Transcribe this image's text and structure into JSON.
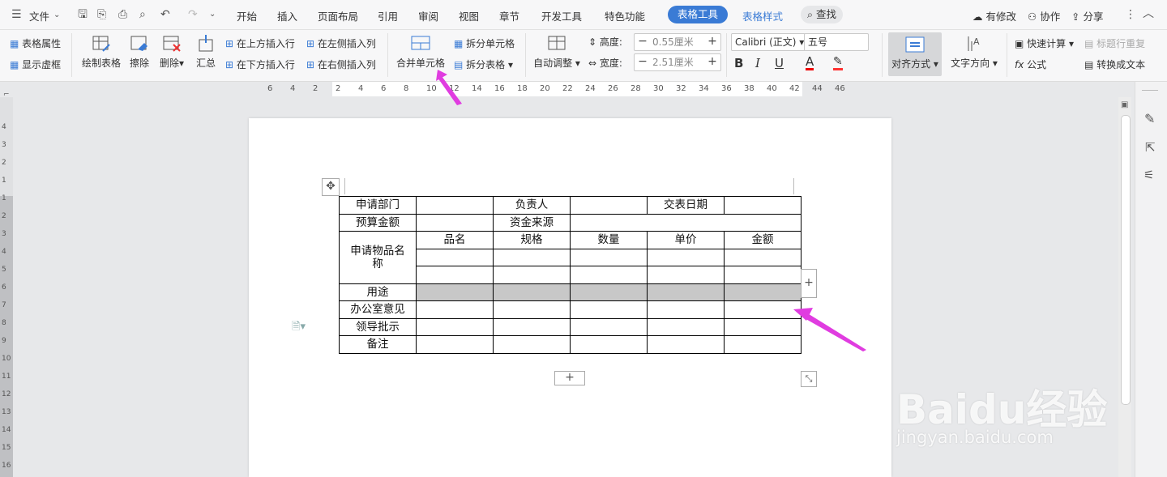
{
  "menubar": {
    "file_label": "文件",
    "tabs": [
      "开始",
      "插入",
      "页面布局",
      "引用",
      "审阅",
      "视图",
      "章节",
      "开发工具",
      "特色功能"
    ],
    "active_tab": "表格工具",
    "secondary_tab": "表格样式",
    "search_label": "查找",
    "changes_label": "有修改",
    "collab_label": "协作",
    "share_label": "分享"
  },
  "ribbon": {
    "table_props": "表格属性",
    "show_gridlines": "显示虚框",
    "draw_table": "绘制表格",
    "erase": "擦除",
    "delete": "删除",
    "summary": "汇总",
    "insert_above": "在上方插入行",
    "insert_below": "在下方插入行",
    "insert_left": "在左侧插入列",
    "insert_right": "在右侧插入列",
    "merge_cells": "合并单元格",
    "split_cells": "拆分单元格",
    "split_table": "拆分表格",
    "auto_fit": "自动调整",
    "height_label": "高度:",
    "height_value": "0.55厘米",
    "width_label": "宽度:",
    "width_value": "2.51厘米",
    "font_name": "Calibri (正文)",
    "font_size": "五号",
    "align": "对齐方式",
    "text_dir": "文字方向",
    "quick_calc": "快速计算",
    "repeat_header": "标题行重复",
    "formula": "公式",
    "to_text": "转换成文本"
  },
  "ruler": {
    "numbers": [
      "6",
      "4",
      "2",
      "2",
      "4",
      "6",
      "8",
      "10",
      "12",
      "14",
      "16",
      "18",
      "20",
      "22",
      "24",
      "26",
      "28",
      "30",
      "32",
      "34",
      "36",
      "38",
      "40",
      "42",
      "44",
      "46"
    ],
    "vertical": [
      "4",
      "3",
      "2",
      "1",
      "1",
      "2",
      "3",
      "4",
      "5",
      "6",
      "7",
      "8",
      "9",
      "10",
      "11",
      "12",
      "13",
      "14",
      "15",
      "16"
    ]
  },
  "table": {
    "rows": [
      [
        "申请部门",
        "",
        "负责人",
        "",
        "交表日期",
        ""
      ],
      [
        "预算金额",
        "",
        "资金来源",
        ""
      ],
      [
        "申请物品名称",
        "品名",
        "规格",
        "数量",
        "单价",
        "金额"
      ],
      [
        "",
        "",
        "",
        "",
        ""
      ],
      [
        "",
        "",
        "",
        "",
        ""
      ],
      [
        "用途",
        "",
        "",
        "",
        "",
        ""
      ],
      [
        "办公室意见",
        "",
        "",
        "",
        "",
        ""
      ],
      [
        "领导批示",
        "",
        "",
        "",
        "",
        ""
      ],
      [
        "备注",
        "",
        "",
        "",
        "",
        ""
      ]
    ]
  },
  "watermark": {
    "brand": "Baidu经验",
    "url": "jingyan.baidu.com"
  },
  "colors": {
    "accent": "#3a7bd5",
    "arrow": "#e03ce0",
    "selection": "#c8c8c8"
  }
}
